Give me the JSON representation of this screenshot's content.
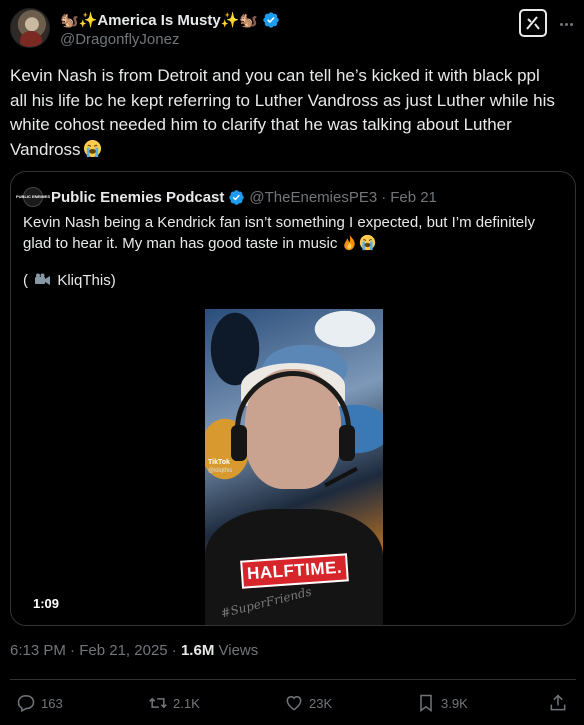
{
  "author": {
    "display_name": "🐿️✨America Is Musty✨🐿️",
    "handle": "@DragonflyJonez",
    "verified": true
  },
  "tweet": {
    "lines": [
      "Kevin Nash is from Detroit and you can tell he’s kicked it with black ppl",
      "all his life bc he kept referring to Luther Vandross as just Luther while his",
      "white cohost needed him to clarify that he was talking about Luther",
      "Vandross"
    ],
    "emoji": "loudly-crying-face"
  },
  "quoted": {
    "avatar_text": "PUBLIC ENEMIES",
    "display_name": "Public Enemies Podcast",
    "handle": "@TheEnemiesPE3",
    "separator": "·",
    "date": "Feb 21",
    "text_lines": [
      "Kevin Nash being a Kendrick fan isn’t something I expected, but I’m definitely",
      "glad to hear it. My man has good taste in music"
    ],
    "emojis": [
      "fire",
      "loudly-crying-face"
    ],
    "credit_open": "(",
    "credit_icon": "movie-camera-icon",
    "credit_text": "KliqThis)",
    "video": {
      "overlay_text": "HALFTIME.",
      "shirt_text": "#SuperFriends",
      "watermark_brand": "TikTok",
      "watermark_handle": "@kliqthis",
      "duration": "1:09"
    }
  },
  "meta": {
    "time": "6:13 PM",
    "separator": "·",
    "date": "Feb 21, 2025",
    "separator2": "·",
    "views_count": "1.6M",
    "views_label": "Views"
  },
  "actions": {
    "replies": "163",
    "reposts": "2.1K",
    "likes": "23K",
    "bookmarks": "3.9K"
  },
  "colors": {
    "background": "#000000",
    "text": "#e7e9ea",
    "secondary": "#71767b",
    "border": "#2f3336",
    "verified": "#1d9bf0",
    "halftime": "#d6262b"
  }
}
